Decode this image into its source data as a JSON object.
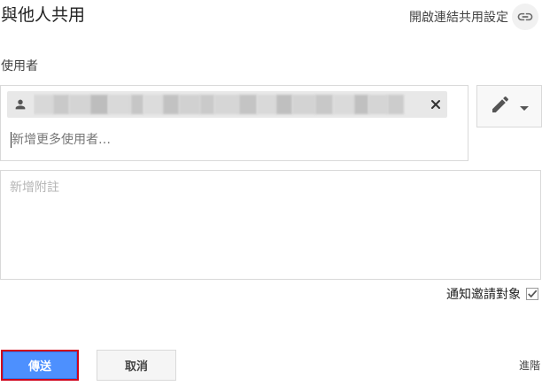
{
  "dialog": {
    "title": "與他人共用",
    "link_settings_label": "開啟連結共用設定",
    "link_icon": "link-icon"
  },
  "people": {
    "section_label": "使用者",
    "chip": {
      "person_icon": "person-icon",
      "name_redacted": true,
      "remove_icon": "close-icon"
    },
    "add_placeholder": "新增更多使用者…",
    "permission_icon": "pencil-icon",
    "permission_dropdown_icon": "caret-down-icon"
  },
  "note": {
    "placeholder": "新增附註"
  },
  "notify": {
    "label": "通知邀請對象",
    "checked": true
  },
  "actions": {
    "send_label": "傳送",
    "cancel_label": "取消",
    "advanced_label": "進階"
  },
  "colors": {
    "send_bg": "#4d90fe",
    "send_highlight_border": "#d0021b",
    "chip_bg": "#e8e8e8",
    "border": "#d9d9d9"
  }
}
